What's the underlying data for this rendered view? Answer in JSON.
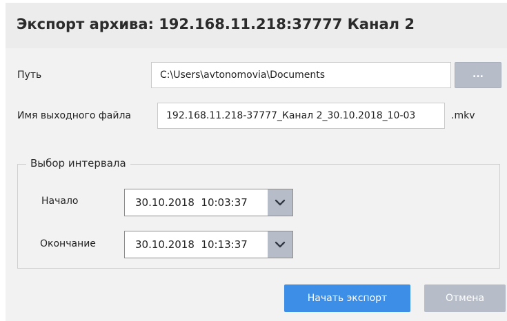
{
  "dialog": {
    "title": "Экспорт архива: 192.168.11.218:37777 Канал 2"
  },
  "path": {
    "label": "Путь",
    "value": "C:\\Users\\avtonomovia\\Documents",
    "browse_label": "..."
  },
  "output_file": {
    "label": "Имя выходного файла",
    "value": "192.168.11.218-37777_Канал 2_30.10.2018_10-03",
    "extension": ".mkv"
  },
  "interval": {
    "legend": "Выбор интервала",
    "start_label": "Начало",
    "start_value": "30.10.2018  10:03:37",
    "end_label": "Окончание",
    "end_value": "30.10.2018  10:13:37"
  },
  "actions": {
    "start_export_label": "Начать экспорт",
    "cancel_label": "Отмена"
  },
  "colors": {
    "primary_button": "#3d8ee6",
    "secondary_button": "#b6bdc8",
    "title_bar": "#ececec",
    "body_background": "#f2f2f2"
  },
  "icons": {
    "dropdown": "chevron-down-icon"
  }
}
